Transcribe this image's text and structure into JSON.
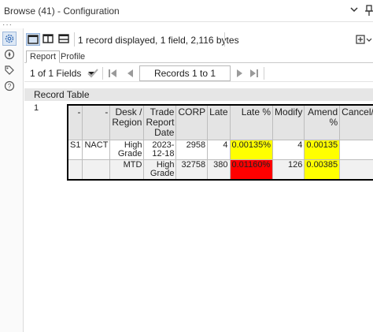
{
  "window": {
    "title": "Browse (41) - Configuration"
  },
  "toolbar": {
    "info": "1 record displayed, 1 field, 2,116 bytes"
  },
  "tabs": [
    {
      "label": "Report",
      "active": true
    },
    {
      "label": "Profile",
      "active": false
    }
  ],
  "nav": {
    "fields_label": "1 of 1 Fields",
    "records_label": "Records 1 to 1"
  },
  "report": {
    "section_title": "Record Table",
    "row_number": "1",
    "columns": [
      "-",
      "-",
      "Desk / Region",
      "Trade Report Date",
      "CORP",
      "Late",
      "Late %",
      "Modify",
      "Amend %",
      "Cancel/Reve"
    ],
    "rows": [
      [
        "S1",
        "NACT",
        "High Grade",
        "2023-12-18",
        "2958",
        "4",
        "0.00135%",
        "4",
        "0.00135",
        ""
      ],
      [
        "",
        "",
        "MTD",
        "High Grade",
        "32758",
        "380",
        "0.01160%",
        "126",
        "0.00385",
        ""
      ]
    ]
  },
  "colors": {
    "highlight_yellow": "#ffff00",
    "highlight_red": "#ff0000",
    "accent": "#3a6fb7"
  }
}
